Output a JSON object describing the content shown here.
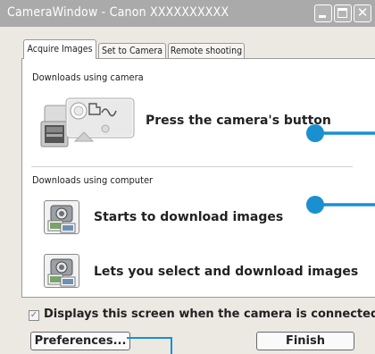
{
  "window": {
    "title": "CameraWindow - Canon XXXXXXXXXX",
    "minimize_icon": "minimize-icon",
    "maximize_icon": "maximize-icon",
    "close_icon": "close-icon",
    "close_glyph": "✕"
  },
  "tabs": [
    {
      "label": "Acquire Images",
      "active": true
    },
    {
      "label": "Set to Camera",
      "active": false
    },
    {
      "label": "Remote shooting",
      "active": false
    }
  ],
  "camera_section": {
    "label": "Downloads using camera",
    "action_text": "Press the camera's button",
    "illustration_icon": "camera-connect-illustration"
  },
  "computer_section": {
    "label": "Downloads using computer",
    "actions": [
      {
        "label": "Starts to download images",
        "icon": "camera-download-icon"
      },
      {
        "label": "Lets you select and download images",
        "icon": "camera-select-icon"
      }
    ]
  },
  "startup_checkbox": {
    "label": "Displays this screen when the camera is connected",
    "checked": true,
    "check_glyph": "✓"
  },
  "buttons": {
    "preferences": "Preferences...",
    "finish": "Finish"
  },
  "colors": {
    "callout": "#1a90d0",
    "titlebar": "#aaaaaa"
  }
}
